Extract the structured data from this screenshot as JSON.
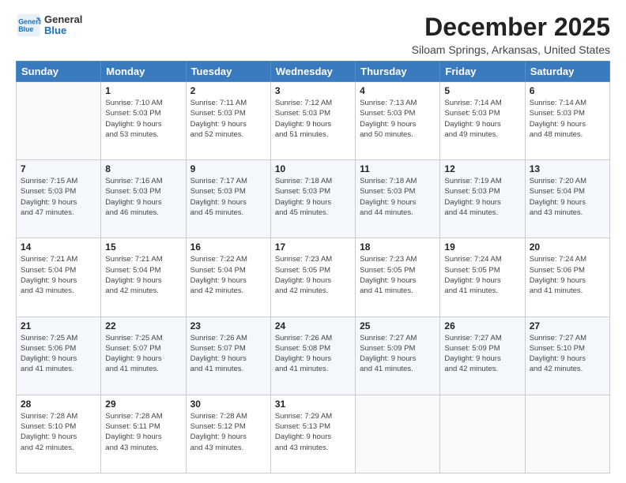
{
  "logo": {
    "line1": "General",
    "line2": "Blue"
  },
  "title": "December 2025",
  "subtitle": "Siloam Springs, Arkansas, United States",
  "weekdays": [
    "Sunday",
    "Monday",
    "Tuesday",
    "Wednesday",
    "Thursday",
    "Friday",
    "Saturday"
  ],
  "weeks": [
    [
      {
        "day": "",
        "info": ""
      },
      {
        "day": "1",
        "info": "Sunrise: 7:10 AM\nSunset: 5:03 PM\nDaylight: 9 hours\nand 53 minutes."
      },
      {
        "day": "2",
        "info": "Sunrise: 7:11 AM\nSunset: 5:03 PM\nDaylight: 9 hours\nand 52 minutes."
      },
      {
        "day": "3",
        "info": "Sunrise: 7:12 AM\nSunset: 5:03 PM\nDaylight: 9 hours\nand 51 minutes."
      },
      {
        "day": "4",
        "info": "Sunrise: 7:13 AM\nSunset: 5:03 PM\nDaylight: 9 hours\nand 50 minutes."
      },
      {
        "day": "5",
        "info": "Sunrise: 7:14 AM\nSunset: 5:03 PM\nDaylight: 9 hours\nand 49 minutes."
      },
      {
        "day": "6",
        "info": "Sunrise: 7:14 AM\nSunset: 5:03 PM\nDaylight: 9 hours\nand 48 minutes."
      }
    ],
    [
      {
        "day": "7",
        "info": "Sunrise: 7:15 AM\nSunset: 5:03 PM\nDaylight: 9 hours\nand 47 minutes."
      },
      {
        "day": "8",
        "info": "Sunrise: 7:16 AM\nSunset: 5:03 PM\nDaylight: 9 hours\nand 46 minutes."
      },
      {
        "day": "9",
        "info": "Sunrise: 7:17 AM\nSunset: 5:03 PM\nDaylight: 9 hours\nand 45 minutes."
      },
      {
        "day": "10",
        "info": "Sunrise: 7:18 AM\nSunset: 5:03 PM\nDaylight: 9 hours\nand 45 minutes."
      },
      {
        "day": "11",
        "info": "Sunrise: 7:18 AM\nSunset: 5:03 PM\nDaylight: 9 hours\nand 44 minutes."
      },
      {
        "day": "12",
        "info": "Sunrise: 7:19 AM\nSunset: 5:03 PM\nDaylight: 9 hours\nand 44 minutes."
      },
      {
        "day": "13",
        "info": "Sunrise: 7:20 AM\nSunset: 5:04 PM\nDaylight: 9 hours\nand 43 minutes."
      }
    ],
    [
      {
        "day": "14",
        "info": "Sunrise: 7:21 AM\nSunset: 5:04 PM\nDaylight: 9 hours\nand 43 minutes."
      },
      {
        "day": "15",
        "info": "Sunrise: 7:21 AM\nSunset: 5:04 PM\nDaylight: 9 hours\nand 42 minutes."
      },
      {
        "day": "16",
        "info": "Sunrise: 7:22 AM\nSunset: 5:04 PM\nDaylight: 9 hours\nand 42 minutes."
      },
      {
        "day": "17",
        "info": "Sunrise: 7:23 AM\nSunset: 5:05 PM\nDaylight: 9 hours\nand 42 minutes."
      },
      {
        "day": "18",
        "info": "Sunrise: 7:23 AM\nSunset: 5:05 PM\nDaylight: 9 hours\nand 41 minutes."
      },
      {
        "day": "19",
        "info": "Sunrise: 7:24 AM\nSunset: 5:05 PM\nDaylight: 9 hours\nand 41 minutes."
      },
      {
        "day": "20",
        "info": "Sunrise: 7:24 AM\nSunset: 5:06 PM\nDaylight: 9 hours\nand 41 minutes."
      }
    ],
    [
      {
        "day": "21",
        "info": "Sunrise: 7:25 AM\nSunset: 5:06 PM\nDaylight: 9 hours\nand 41 minutes."
      },
      {
        "day": "22",
        "info": "Sunrise: 7:25 AM\nSunset: 5:07 PM\nDaylight: 9 hours\nand 41 minutes."
      },
      {
        "day": "23",
        "info": "Sunrise: 7:26 AM\nSunset: 5:07 PM\nDaylight: 9 hours\nand 41 minutes."
      },
      {
        "day": "24",
        "info": "Sunrise: 7:26 AM\nSunset: 5:08 PM\nDaylight: 9 hours\nand 41 minutes."
      },
      {
        "day": "25",
        "info": "Sunrise: 7:27 AM\nSunset: 5:09 PM\nDaylight: 9 hours\nand 41 minutes."
      },
      {
        "day": "26",
        "info": "Sunrise: 7:27 AM\nSunset: 5:09 PM\nDaylight: 9 hours\nand 42 minutes."
      },
      {
        "day": "27",
        "info": "Sunrise: 7:27 AM\nSunset: 5:10 PM\nDaylight: 9 hours\nand 42 minutes."
      }
    ],
    [
      {
        "day": "28",
        "info": "Sunrise: 7:28 AM\nSunset: 5:10 PM\nDaylight: 9 hours\nand 42 minutes."
      },
      {
        "day": "29",
        "info": "Sunrise: 7:28 AM\nSunset: 5:11 PM\nDaylight: 9 hours\nand 43 minutes."
      },
      {
        "day": "30",
        "info": "Sunrise: 7:28 AM\nSunset: 5:12 PM\nDaylight: 9 hours\nand 43 minutes."
      },
      {
        "day": "31",
        "info": "Sunrise: 7:29 AM\nSunset: 5:13 PM\nDaylight: 9 hours\nand 43 minutes."
      },
      {
        "day": "",
        "info": ""
      },
      {
        "day": "",
        "info": ""
      },
      {
        "day": "",
        "info": ""
      }
    ]
  ]
}
